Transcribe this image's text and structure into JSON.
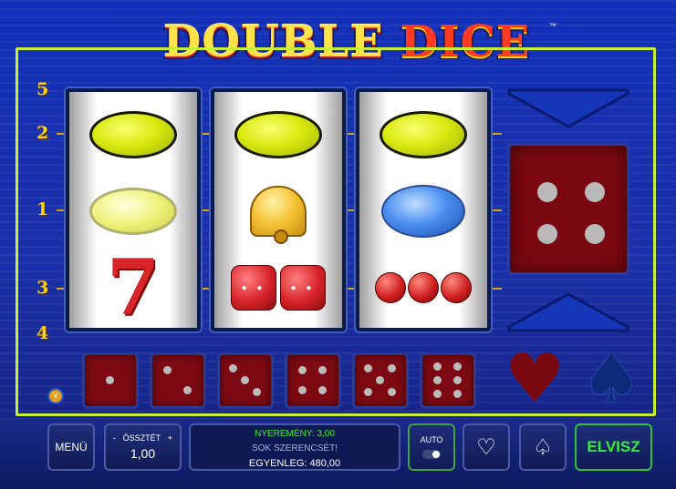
{
  "game": {
    "title_word1": "DOUBLE",
    "title_word2": "DICE",
    "trademark": "™"
  },
  "paylines": [
    "5",
    "2",
    "1",
    "3",
    "4"
  ],
  "reels": [
    {
      "symbols": [
        "lemon",
        "lemon",
        "seven"
      ],
      "seven_glyph": "7"
    },
    {
      "symbols": [
        "lemon",
        "bell",
        "dice"
      ]
    },
    {
      "symbols": [
        "lemon",
        "plum",
        "cherries"
      ]
    }
  ],
  "feature": {
    "big_die_value": 4,
    "small_dice_values": [
      1,
      2,
      3,
      4,
      5,
      6
    ],
    "suits": {
      "heart": "♥",
      "spade": "♠"
    }
  },
  "controls": {
    "menu_label": "MENÜ",
    "bet_label": "ÖSSZTÉT",
    "bet_value": "1,00",
    "bet_minus": "-",
    "bet_plus": "+",
    "win_text": "NYEREMÉNY: 3,00",
    "luck_text": "SOK SZERENCSÉT!",
    "balance_text": "EGYENLEG: 480,00",
    "auto_label": "AUTO",
    "heart_glyph": "♡",
    "spade_glyph": "♤",
    "collect_label": "ELVISZ"
  },
  "colors": {
    "frame": "#c6ef36",
    "win_text": "#3bea36",
    "collect_button": "#35c23a",
    "die_face": "#7d0a12"
  }
}
